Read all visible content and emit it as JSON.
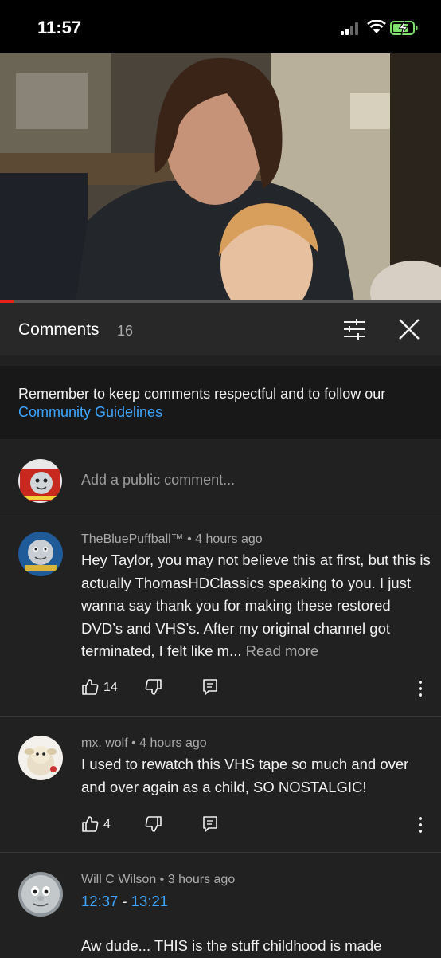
{
  "status_bar": {
    "time": "11:57"
  },
  "comments_panel": {
    "title": "Comments",
    "count": "16",
    "notice_text": "Remember to keep comments respectful and to follow our ",
    "notice_link": "Community Guidelines",
    "add_comment_placeholder": "Add a public comment..."
  },
  "comments": [
    {
      "author": "TheBluePuffball™",
      "time": "4 hours ago",
      "text": "Hey Taylor, you may not believe this at first, but this is actually ThomasHDClassics speaking to you. I just wanna say thank you for making these restored DVD’s and VHS’s. After my original channel got terminated, I felt like m...",
      "read_more": "Read more",
      "likes": "14"
    },
    {
      "author": "mx. wolf",
      "time": "4 hours ago",
      "text": "I used to rewatch this VHS tape so much and over and over again as a child, SO NOSTALGIC!",
      "likes": "4"
    },
    {
      "author": "Will C Wilson",
      "time": "3 hours ago",
      "timestamp_start": "12:37",
      "timestamp_sep": " - ",
      "timestamp_end": "13:21",
      "text": "Aw dude... THIS is the stuff childhood is made"
    }
  ],
  "separator": " • ",
  "colors": {
    "background": "#212121",
    "link": "#3ea6ff",
    "progress": "#e62117"
  }
}
